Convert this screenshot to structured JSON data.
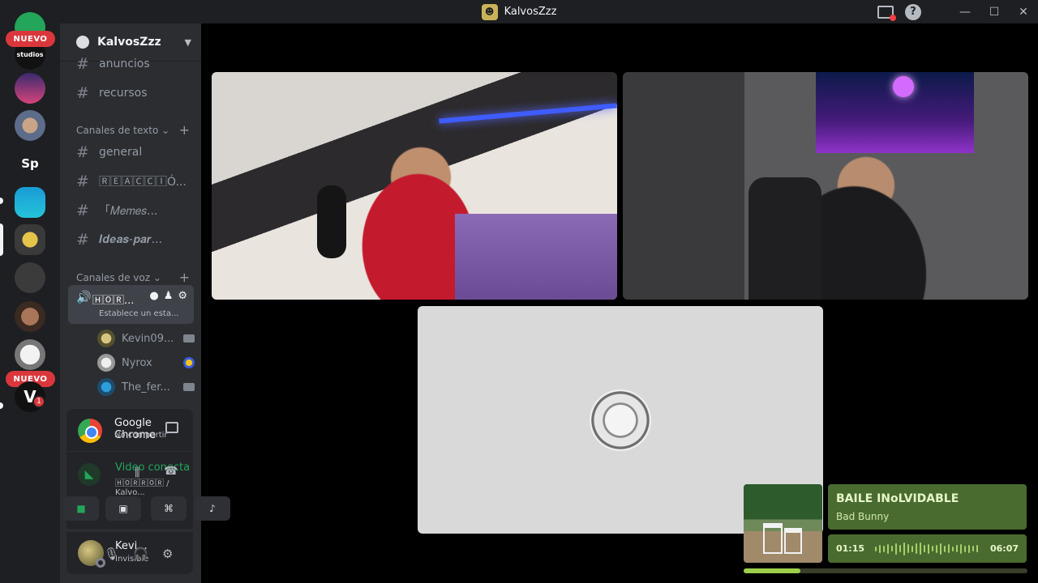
{
  "window": {
    "title": "KalvosZzz"
  },
  "rail": {
    "nuevo_badge_1": "NUEVO",
    "nuevo_badge_2": "NUEVO",
    "text_server": "Sp",
    "unread_count": "1"
  },
  "guild": {
    "name": "KalvosZzz"
  },
  "channels": {
    "top": [
      {
        "name": "anuncios"
      },
      {
        "name": "recursos"
      }
    ],
    "text_category": "Canales de texto",
    "text": [
      {
        "name": "general"
      },
      {
        "name": "🅁🄴🄰🄲🄲🄸Ó..."
      },
      {
        "name": "「𝑀𝑒𝑚𝑒𝑠..."
      },
      {
        "name": "𝑰𝒅𝒆𝒂𝒔-𝒑𝒂𝒓..."
      }
    ],
    "voice_category": "Canales de voz",
    "voice_channel": {
      "name": "🄷🄾🅁...",
      "status": "Establece un esta..."
    },
    "voice_users": [
      {
        "name": "Kevin09..."
      },
      {
        "name": "Nyrox"
      },
      {
        "name": "The_fer..."
      }
    ]
  },
  "activity": {
    "app": "Google Chrome",
    "status": "No compartir"
  },
  "voice": {
    "status": "Video conectado",
    "channel": "🄷🄾🅁🅁🄾🅁 / Kalvo..."
  },
  "user": {
    "name": "Kevi...",
    "status": "Invisible"
  },
  "music": {
    "title": "BAILE INoLVIDABLE",
    "artist": "Bad Bunny",
    "elapsed": "01:15",
    "duration": "06:07",
    "progress": 0.2
  },
  "colors": {
    "accent_green": "#23a55a",
    "nuevo_red": "#da373c",
    "music_card": "#4a6b2f"
  }
}
